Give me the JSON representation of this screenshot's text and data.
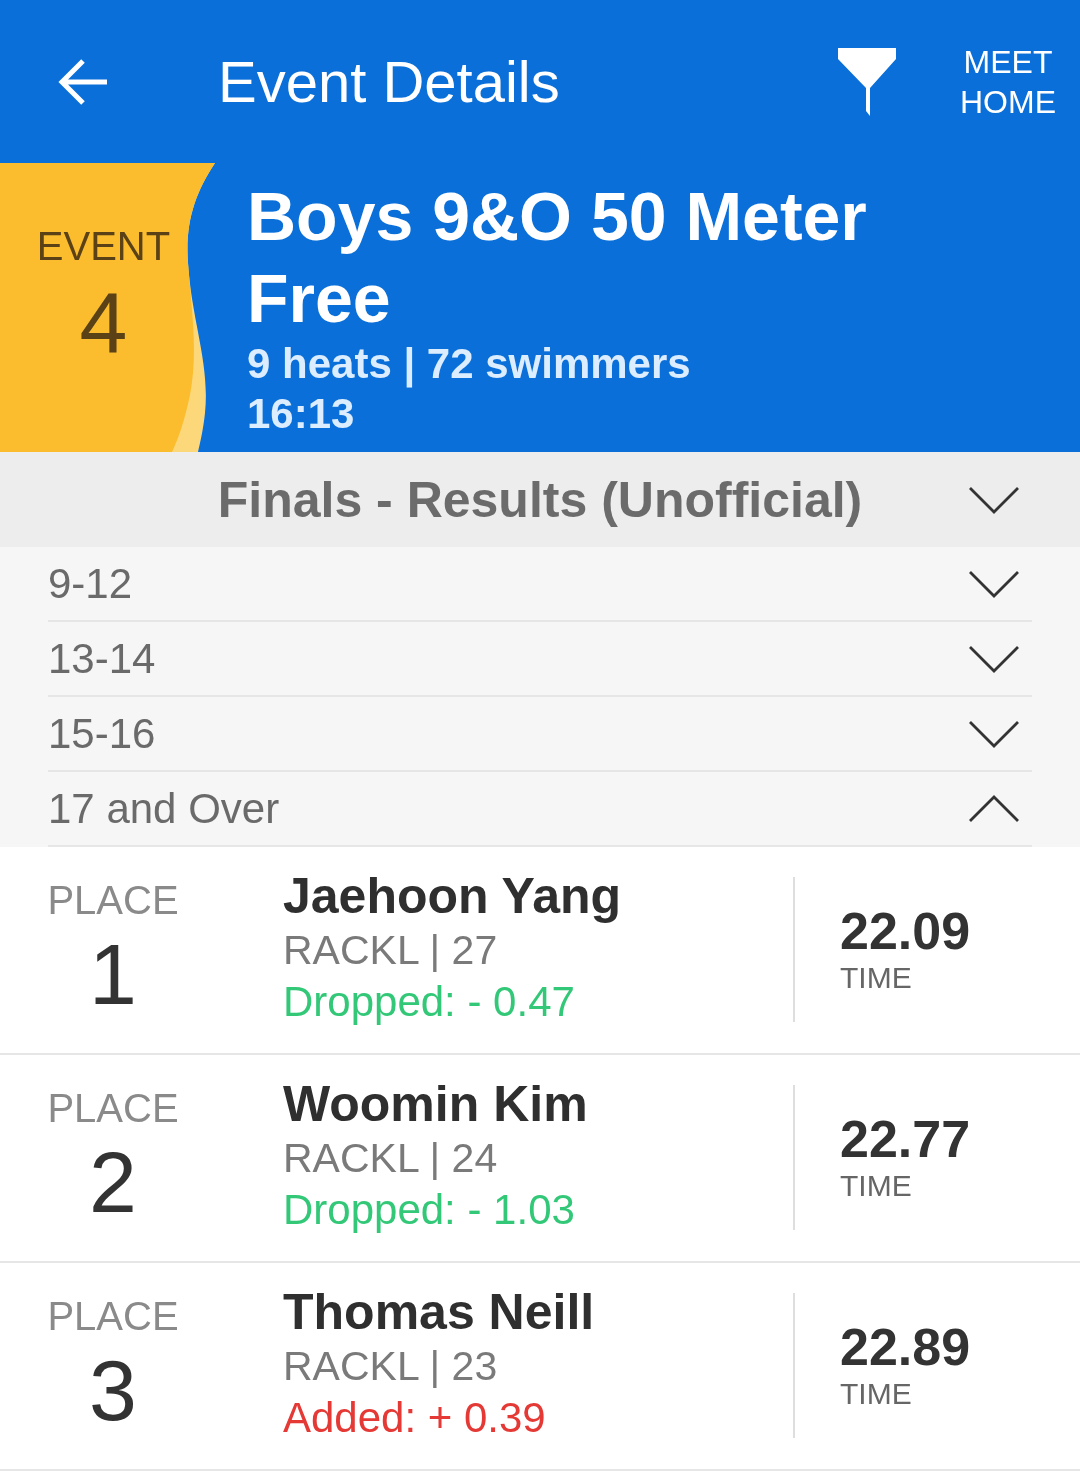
{
  "header": {
    "title": "Event Details",
    "action": "MEET HOME"
  },
  "event": {
    "label": "EVENT",
    "number": "4",
    "title": "Boys 9&O 50 Meter Free",
    "summary": "9 heats | 72 swimmers",
    "time": "16:13"
  },
  "section": {
    "title": "Finals - Results (Unofficial)",
    "expanded": false
  },
  "age_groups": [
    {
      "label": "9-12",
      "expanded": false
    },
    {
      "label": "13-14",
      "expanded": false
    },
    {
      "label": "15-16",
      "expanded": false
    },
    {
      "label": "17 and Over",
      "expanded": true,
      "results": [
        {
          "place_label": "PLACE",
          "place": "1",
          "name": "Jaehoon Yang",
          "team": "RACKL | 27",
          "change": {
            "kind": "dropped",
            "text": "Dropped: - 0.47"
          },
          "time": "22.09",
          "time_label": "TIME"
        },
        {
          "place_label": "PLACE",
          "place": "2",
          "name": "Woomin Kim",
          "team": "RACKL | 24",
          "change": {
            "kind": "dropped",
            "text": "Dropped: - 1.03"
          },
          "time": "22.77",
          "time_label": "TIME"
        },
        {
          "place_label": "PLACE",
          "place": "3",
          "name": "Thomas Neill",
          "team": "RACKL | 23",
          "change": {
            "kind": "added",
            "text": "Added: + 0.39"
          },
          "time": "22.89",
          "time_label": "TIME"
        }
      ]
    }
  ]
}
